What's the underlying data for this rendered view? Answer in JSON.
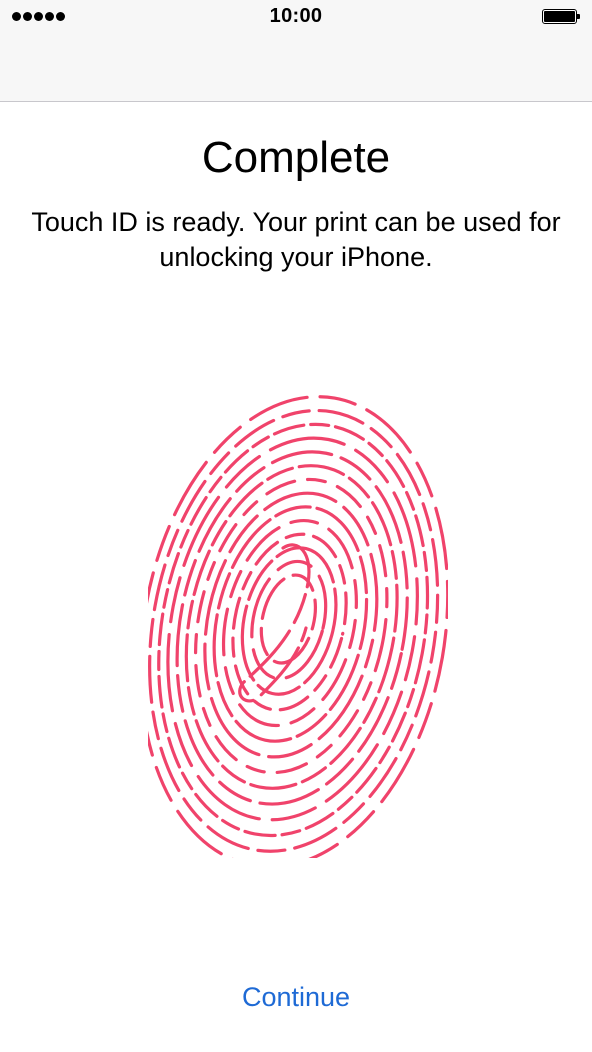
{
  "status_bar": {
    "time": "10:00",
    "signal_icon": "signal-dots-icon",
    "battery_icon": "battery-full-icon"
  },
  "content": {
    "title": "Complete",
    "subtitle": "Touch ID is ready. Your print can be used for unlocking your iPhone.",
    "fingerprint_icon": "fingerprint-icon",
    "fingerprint_color": "#f0436b"
  },
  "actions": {
    "continue_label": "Continue",
    "link_color": "#1e6ad5"
  }
}
